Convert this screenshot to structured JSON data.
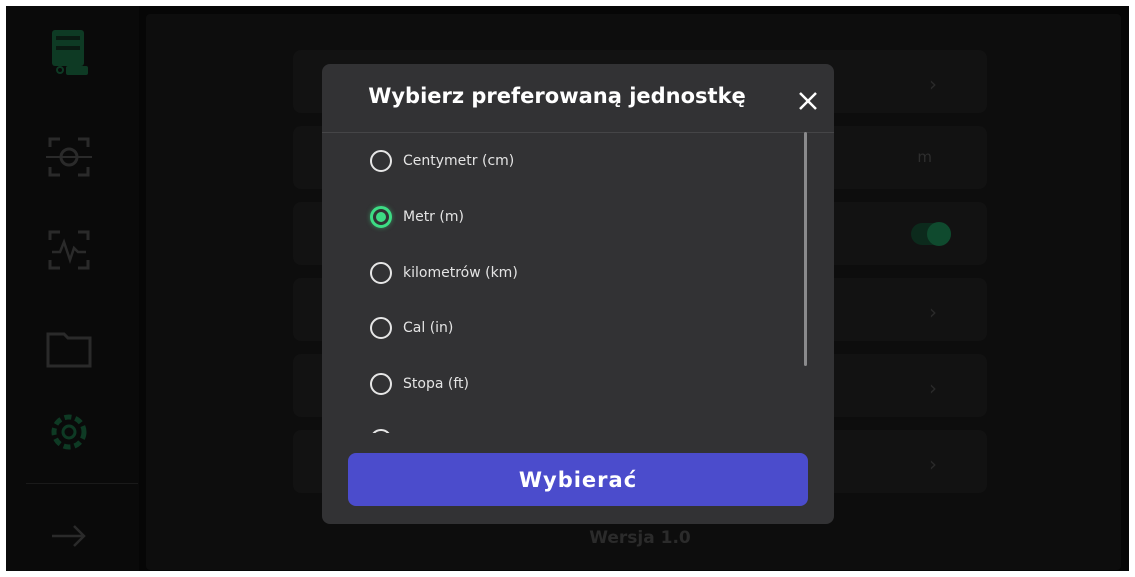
{
  "modal": {
    "title": "Wybierz preferowaną jednostkę",
    "close_icon": "close-icon",
    "options": [
      {
        "label": "Centymetr (cm)",
        "selected": false
      },
      {
        "label": "Metr (m)",
        "selected": true
      },
      {
        "label": "kilometrów (km)",
        "selected": false
      },
      {
        "label": "Cal (in)",
        "selected": false
      },
      {
        "label": "Stopa (ft)",
        "selected": false
      }
    ],
    "submit_label": "Wybierać"
  },
  "background": {
    "unit_value": "m",
    "version": "Wersja 1.0"
  },
  "sidebar": {
    "icons": [
      "storage-icon",
      "scan-icon",
      "health-scan-icon",
      "folder-icon",
      "settings-icon",
      "arrow-right-icon"
    ]
  },
  "colors": {
    "accent_green": "#3ddc84",
    "button_purple": "#4b4ccc",
    "modal_bg": "#323234"
  }
}
